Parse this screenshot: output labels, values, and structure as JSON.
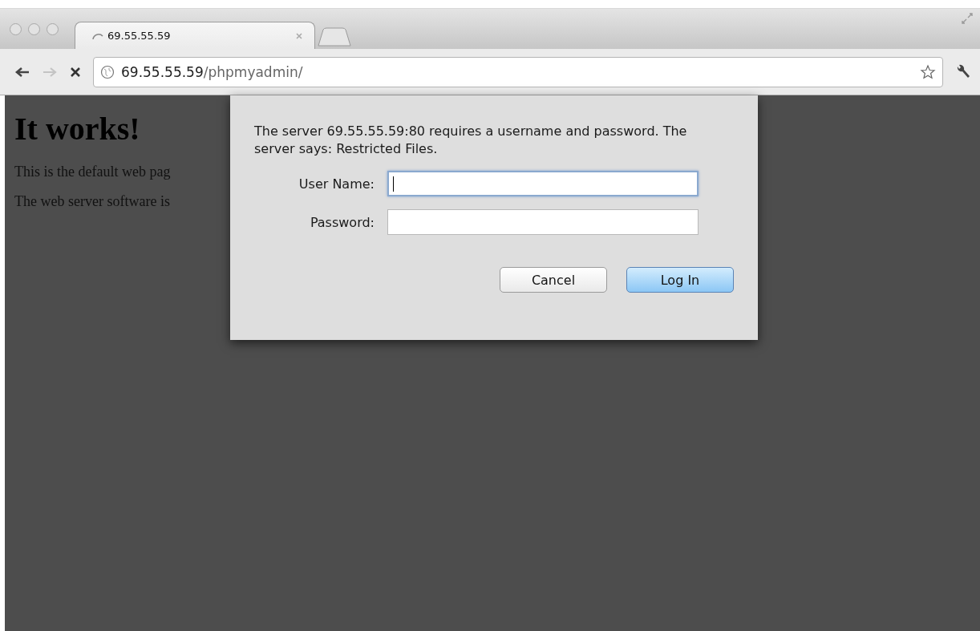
{
  "browser": {
    "tab": {
      "title": "69.55.55.59",
      "loading": true
    },
    "toolbar": {
      "forward_disabled": true,
      "url_host": "69.55.55.59",
      "url_path": "/phpmyadmin/"
    }
  },
  "page": {
    "heading": "It works!",
    "paragraphs": [
      "This is the default web pag",
      "The web server software is"
    ]
  },
  "dialog": {
    "message": "The server 69.55.55.59:80 requires a username and password. The server says: Restricted Files.",
    "fields": [
      {
        "label": "User Name:",
        "focused": true
      },
      {
        "label": "Password:",
        "focused": false
      }
    ],
    "buttons": [
      {
        "label": "Cancel",
        "default": false
      },
      {
        "label": "Log In",
        "default": true
      }
    ]
  }
}
